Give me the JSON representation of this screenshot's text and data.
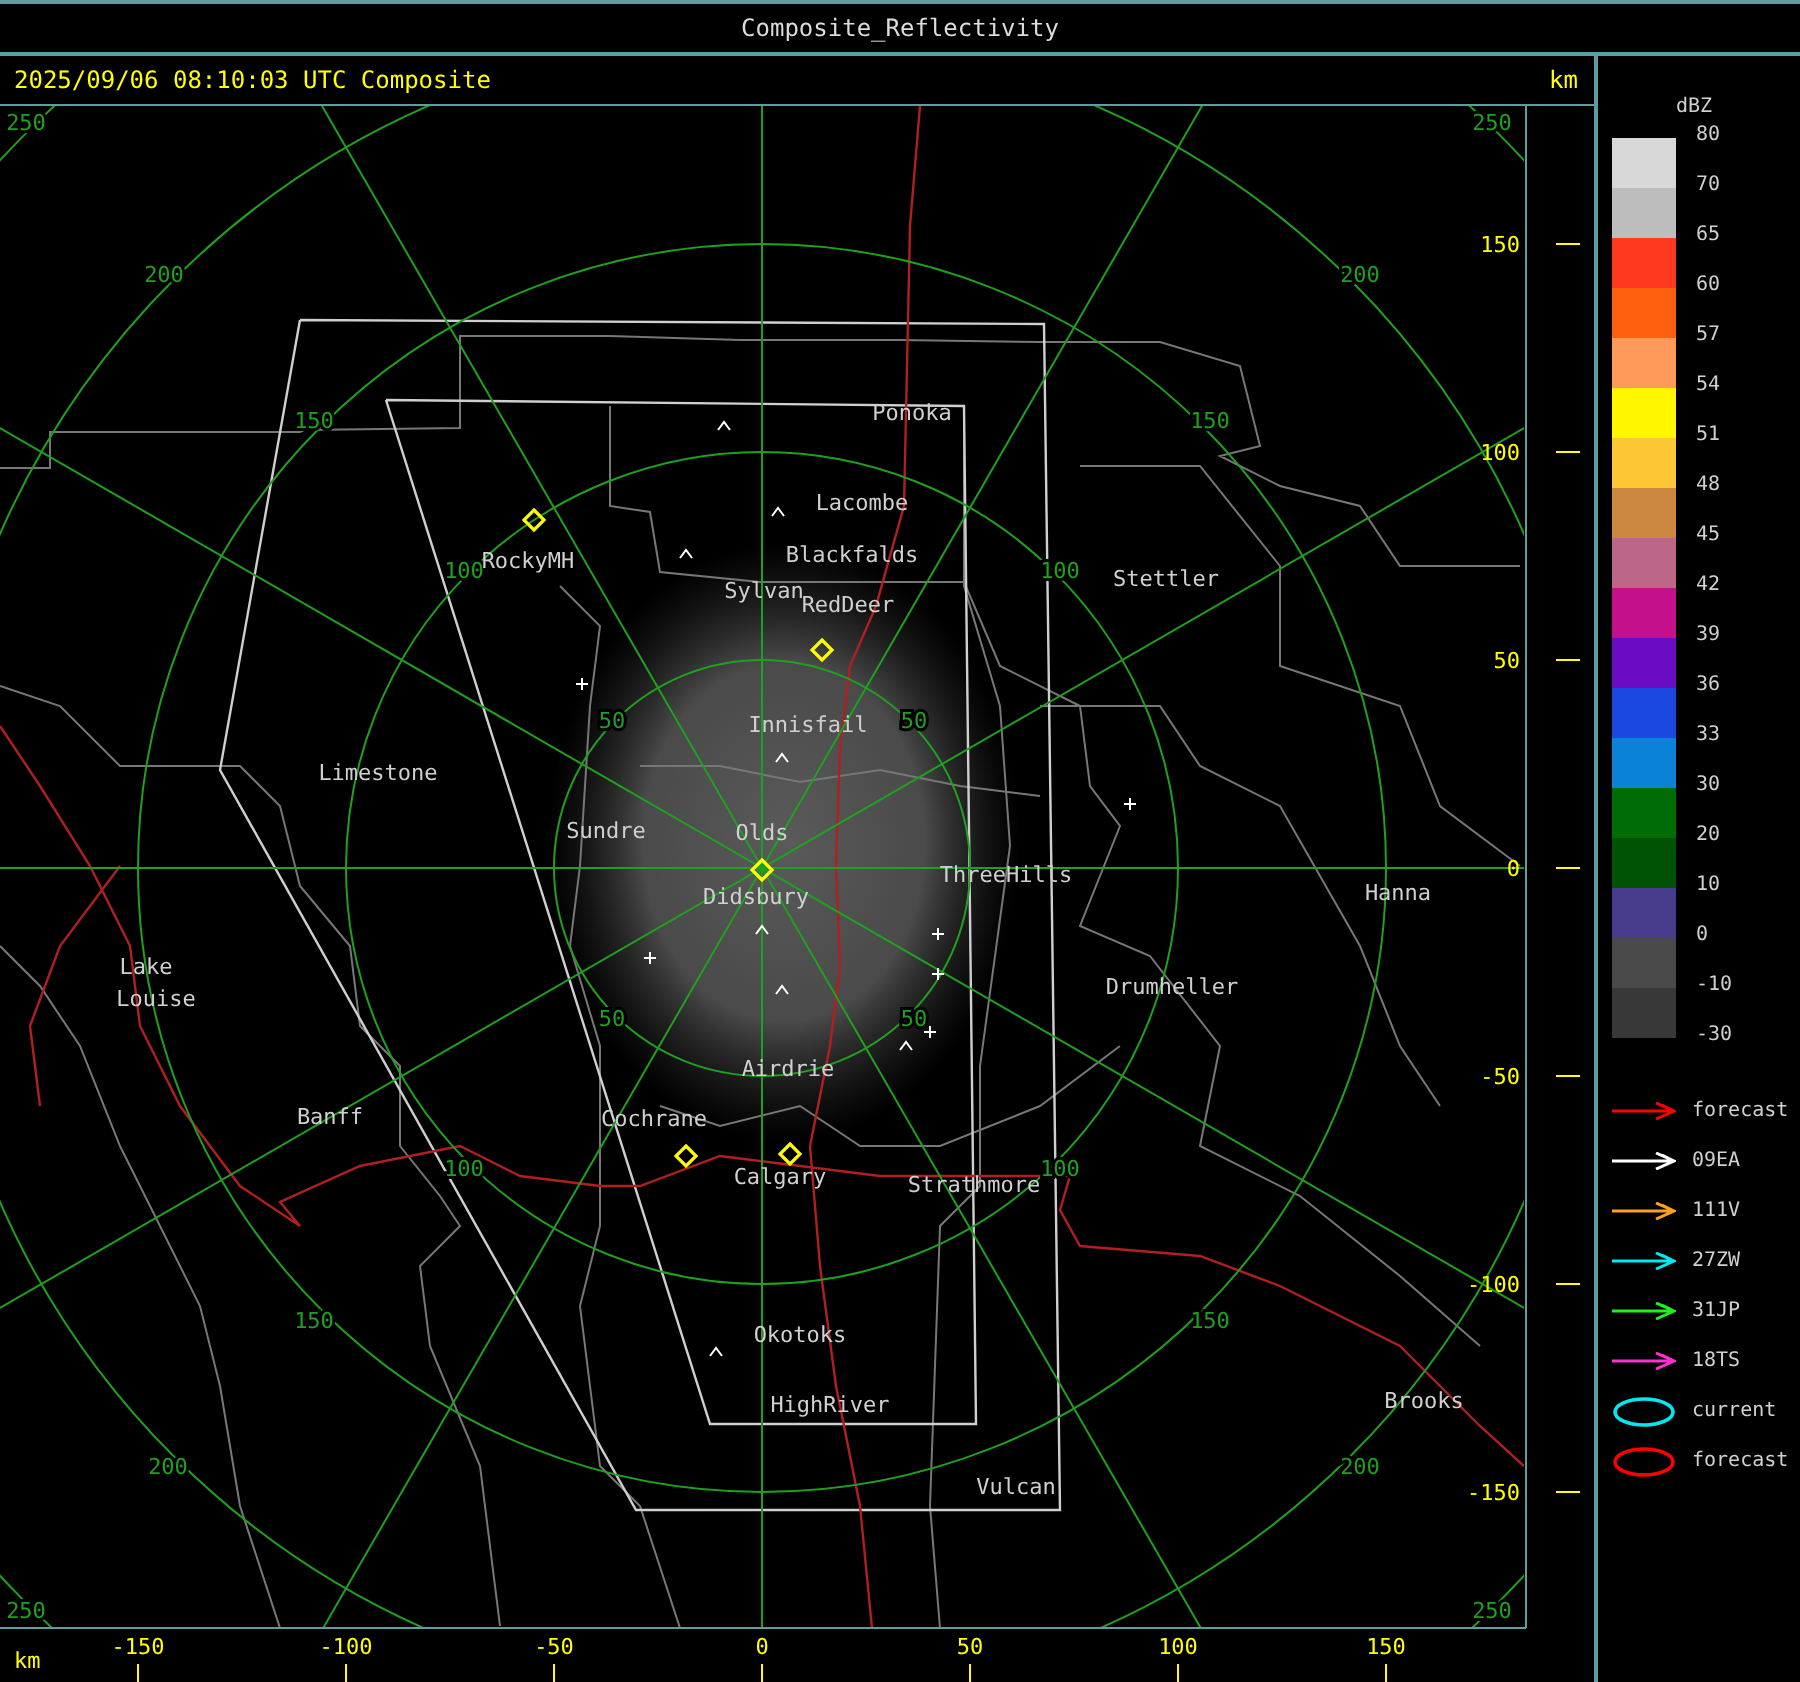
{
  "window": {
    "title": "Composite_Reflectivity"
  },
  "header": {
    "timestamp": "2025/09/06 08:10:03 UTC Composite",
    "unit": "km"
  },
  "map": {
    "places": [
      {
        "name": "Ponoka"
      },
      {
        "name": "Lacombe"
      },
      {
        "name": "Blackfalds"
      },
      {
        "name": "Sylvan"
      },
      {
        "name": "RedDeer"
      },
      {
        "name": "Stettler"
      },
      {
        "name": "RockyMH"
      },
      {
        "name": "Innisfail"
      },
      {
        "name": "Limestone"
      },
      {
        "name": "Sundre"
      },
      {
        "name": "Olds"
      },
      {
        "name": "Didsbury"
      },
      {
        "name": "ThreeHills"
      },
      {
        "name": "Hanna"
      },
      {
        "name": "Lake"
      },
      {
        "name": "Louise"
      },
      {
        "name": "Drumheller"
      },
      {
        "name": "Airdrie"
      },
      {
        "name": "Cochrane"
      },
      {
        "name": "Banff"
      },
      {
        "name": "Calgary"
      },
      {
        "name": "Strathmore"
      },
      {
        "name": "Okotoks"
      },
      {
        "name": "HighRiver"
      },
      {
        "name": "Brooks"
      },
      {
        "name": "Vulcan"
      }
    ],
    "range_labels": [
      "250",
      "250",
      "250",
      "250",
      "200",
      "200",
      "200",
      "200",
      "150",
      "150",
      "150",
      "150",
      "100",
      "100",
      "100",
      "100",
      "50",
      "50",
      "50",
      "50"
    ]
  },
  "axes": {
    "y_ticks": [
      "150",
      "100",
      "50",
      "0",
      "-50",
      "-100",
      "-150"
    ],
    "x_unit": "km",
    "x_ticks": [
      "-150",
      "-100",
      "-50",
      "0",
      "50",
      "100",
      "150"
    ]
  },
  "legend": {
    "unit": "dBZ",
    "levels": [
      {
        "label": "80",
        "color": "#d8d8d8"
      },
      {
        "label": "70",
        "color": "#bdbdbd"
      },
      {
        "label": "65",
        "color": "#ff3820"
      },
      {
        "label": "60",
        "color": "#ff6010"
      },
      {
        "label": "57",
        "color": "#ff9a5a"
      },
      {
        "label": "54",
        "color": "#fff600"
      },
      {
        "label": "51",
        "color": "#fcc634"
      },
      {
        "label": "48",
        "color": "#cc8840"
      },
      {
        "label": "45",
        "color": "#bc6688"
      },
      {
        "label": "42",
        "color": "#c4108a"
      },
      {
        "label": "39",
        "color": "#6a0cc4"
      },
      {
        "label": "36",
        "color": "#1a48e0"
      },
      {
        "label": "33",
        "color": "#0a82d8"
      },
      {
        "label": "30",
        "color": "#006c06"
      },
      {
        "label": "20",
        "color": "#005204"
      },
      {
        "label": "10",
        "color": "#483c8c"
      },
      {
        "label": "0",
        "color": "#4a4a4a"
      },
      {
        "label": "-10",
        "color": "#383838"
      },
      {
        "label": "-30"
      }
    ],
    "tracks": [
      {
        "kind": "arrow",
        "label": "forecast",
        "color": "#ff0000"
      },
      {
        "kind": "arrow",
        "label": "09EA",
        "color": "#ffffff"
      },
      {
        "kind": "arrow",
        "label": "111V",
        "color": "#ffa020"
      },
      {
        "kind": "arrow",
        "label": "27ZW",
        "color": "#00e8f0"
      },
      {
        "kind": "arrow",
        "label": "31JP",
        "color": "#20f020"
      },
      {
        "kind": "arrow",
        "label": "18TS",
        "color": "#ff30d0"
      },
      {
        "kind": "ellipse",
        "label": "current",
        "color": "#00e8f0"
      },
      {
        "kind": "ellipse",
        "label": "forecast",
        "color": "#ff0000"
      }
    ]
  }
}
